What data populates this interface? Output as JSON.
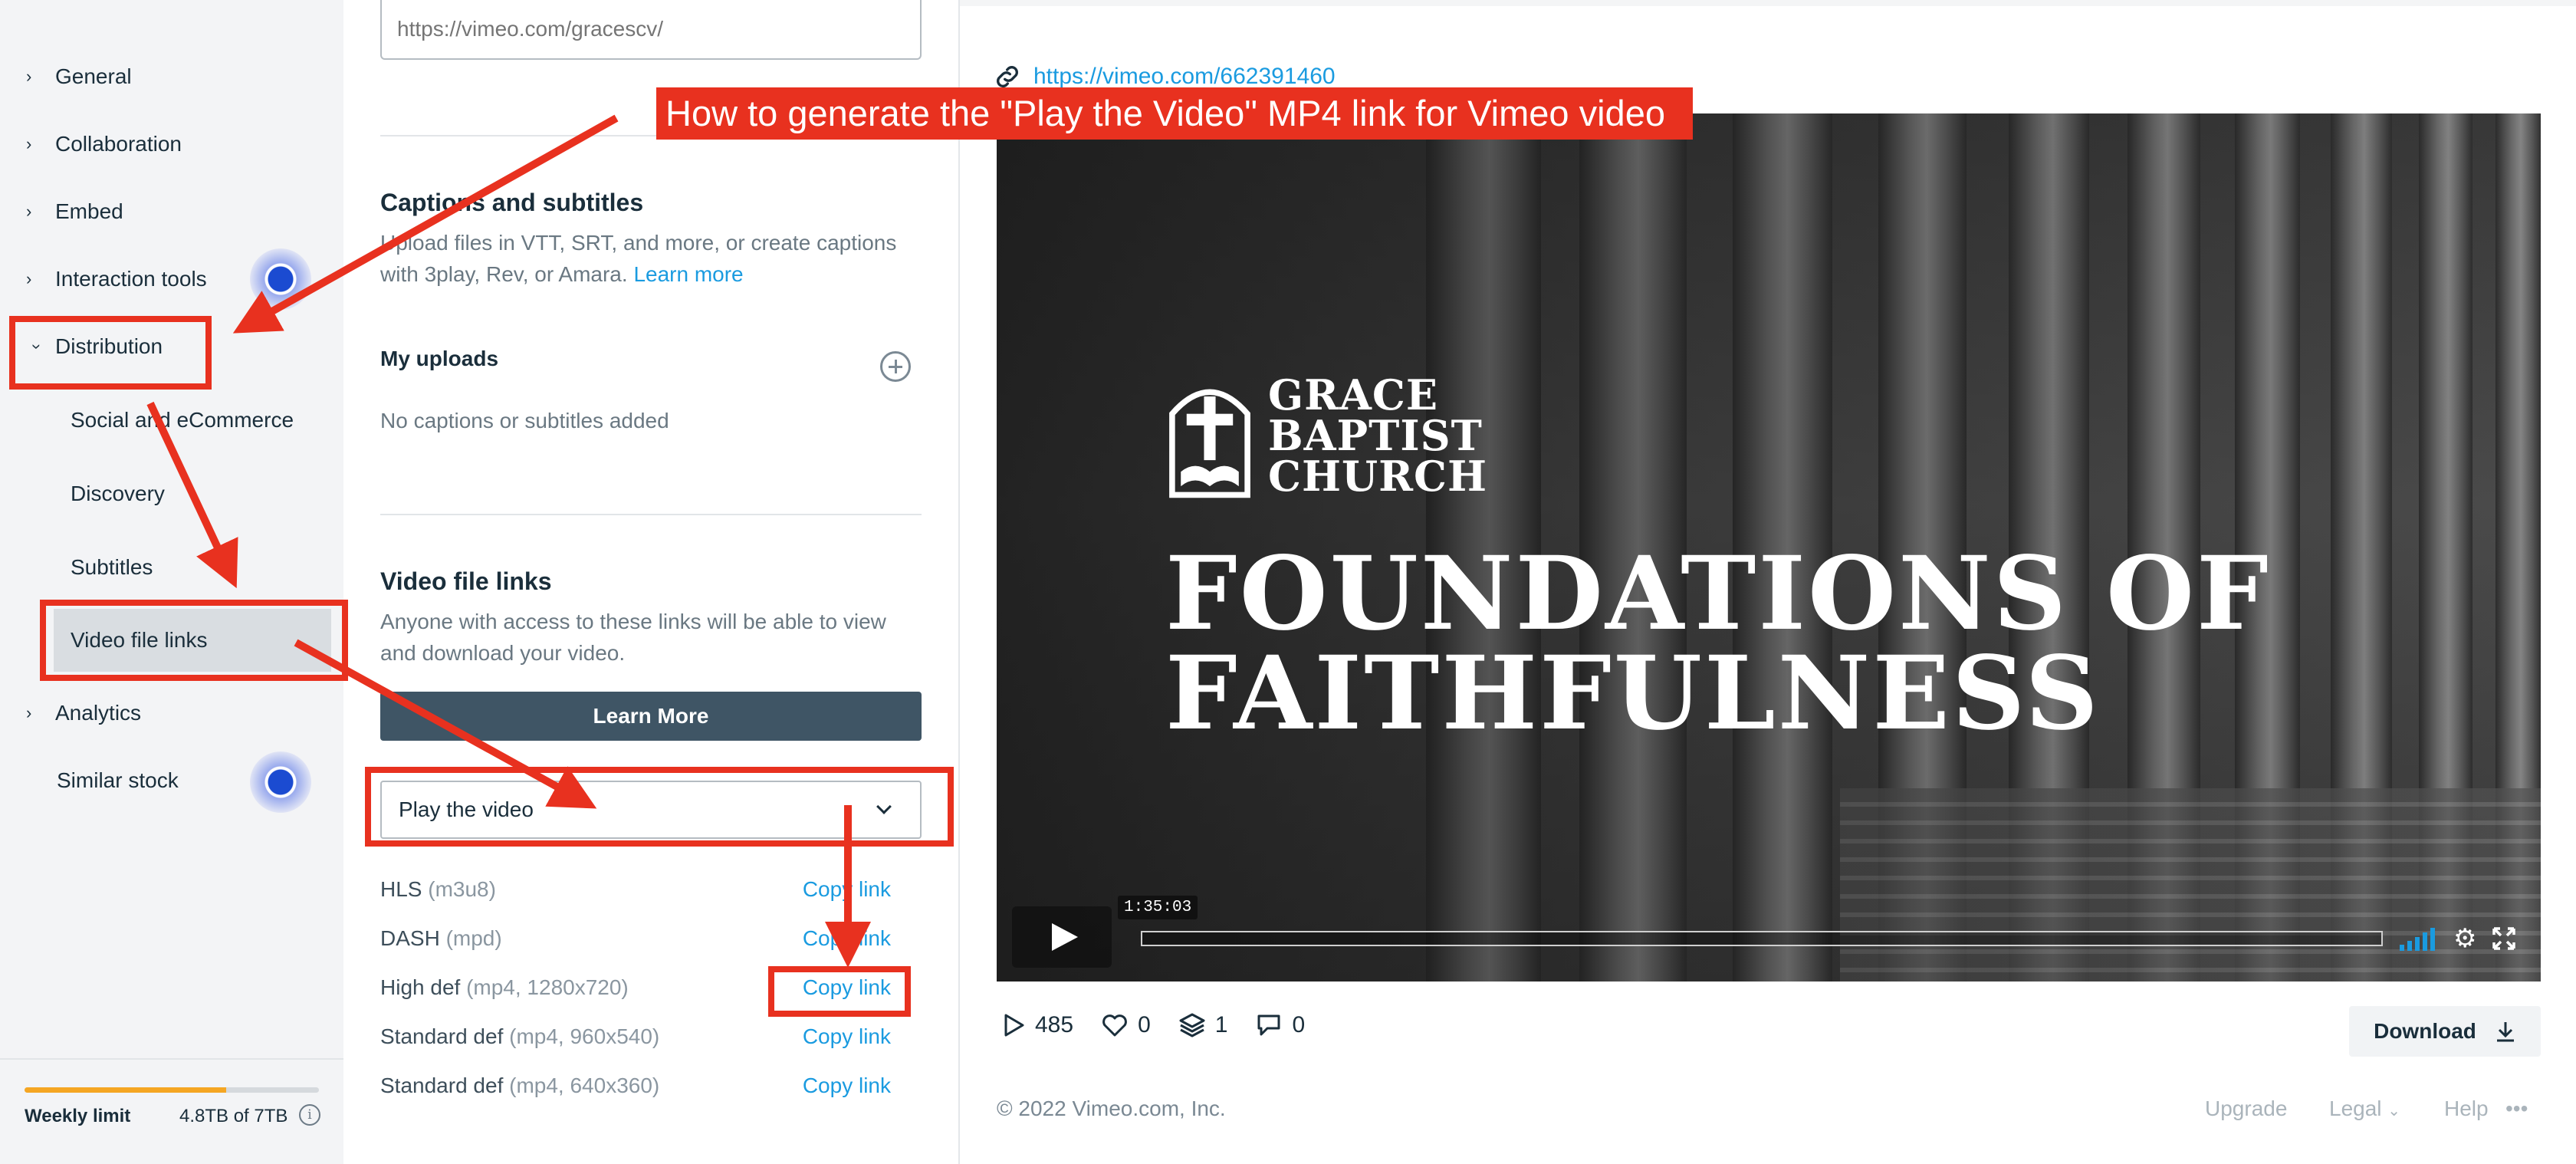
{
  "sidebar": {
    "items": [
      {
        "label": "General",
        "expanded": false
      },
      {
        "label": "Collaboration",
        "expanded": false
      },
      {
        "label": "Embed",
        "expanded": false
      },
      {
        "label": "Interaction tools",
        "expanded": false
      },
      {
        "label": "Distribution",
        "expanded": true
      },
      {
        "label": "Analytics",
        "expanded": false
      }
    ],
    "sub_items": [
      "Social and eCommerce",
      "Discovery",
      "Subtitles",
      "Video file links"
    ],
    "similar_stock": "Similar stock",
    "limit": {
      "label": "Weekly limit",
      "value": "4.8TB of 7TB",
      "fraction": 0.686,
      "color": "#f5a623"
    }
  },
  "middle": {
    "url_placeholder": "https://vimeo.com/gracescv/",
    "captions": {
      "title": "Captions and subtitles",
      "text": "Upload files in VTT, SRT, and more, or create captions with 3play, Rev, or Amara.",
      "learn_more": "Learn more"
    },
    "uploads": {
      "title": "My uploads",
      "empty": "No captions or subtitles added"
    },
    "file_links": {
      "title": "Video file links",
      "text": "Anyone with access to these links will be able to view and download your video.",
      "button": "Learn More",
      "select_value": "Play the video",
      "rows": [
        {
          "name": "HLS",
          "detail": "(m3u8)",
          "action": "Copy link"
        },
        {
          "name": "DASH",
          "detail": "(mpd)",
          "action": "Copy link"
        },
        {
          "name": "High def",
          "detail": "(mp4, 1280x720)",
          "action": "Copy link"
        },
        {
          "name": "Standard def",
          "detail": "(mp4, 960x540)",
          "action": "Copy link"
        },
        {
          "name": "Standard def",
          "detail": "(mp4, 640x360)",
          "action": "Copy link"
        }
      ]
    }
  },
  "right": {
    "video_url": "https://vimeo.com/662391460",
    "thumbnail": {
      "logo_lines": [
        "GRACE",
        "BAPTIST",
        "CHURCH"
      ],
      "headline_lines": [
        "FOUNDATIONS OF",
        "FAITHFULNESS"
      ]
    },
    "player": {
      "duration": "1:35:03"
    },
    "stats": {
      "plays": "485",
      "likes": "0",
      "collections": "1",
      "comments": "0"
    },
    "download_label": "Download",
    "footer": {
      "copyright": "© 2022 Vimeo.com, Inc.",
      "links": [
        "Upgrade",
        "Legal",
        "Help",
        "•••"
      ]
    }
  },
  "annotation": {
    "banner": "How to generate the \"Play the Video\" MP4 link for Vimeo video",
    "color": "#e8311f"
  },
  "colors": {
    "accent": "#1a9be0",
    "button_dark": "#3f5565",
    "sidebar_bg": "#f3f4f6"
  }
}
